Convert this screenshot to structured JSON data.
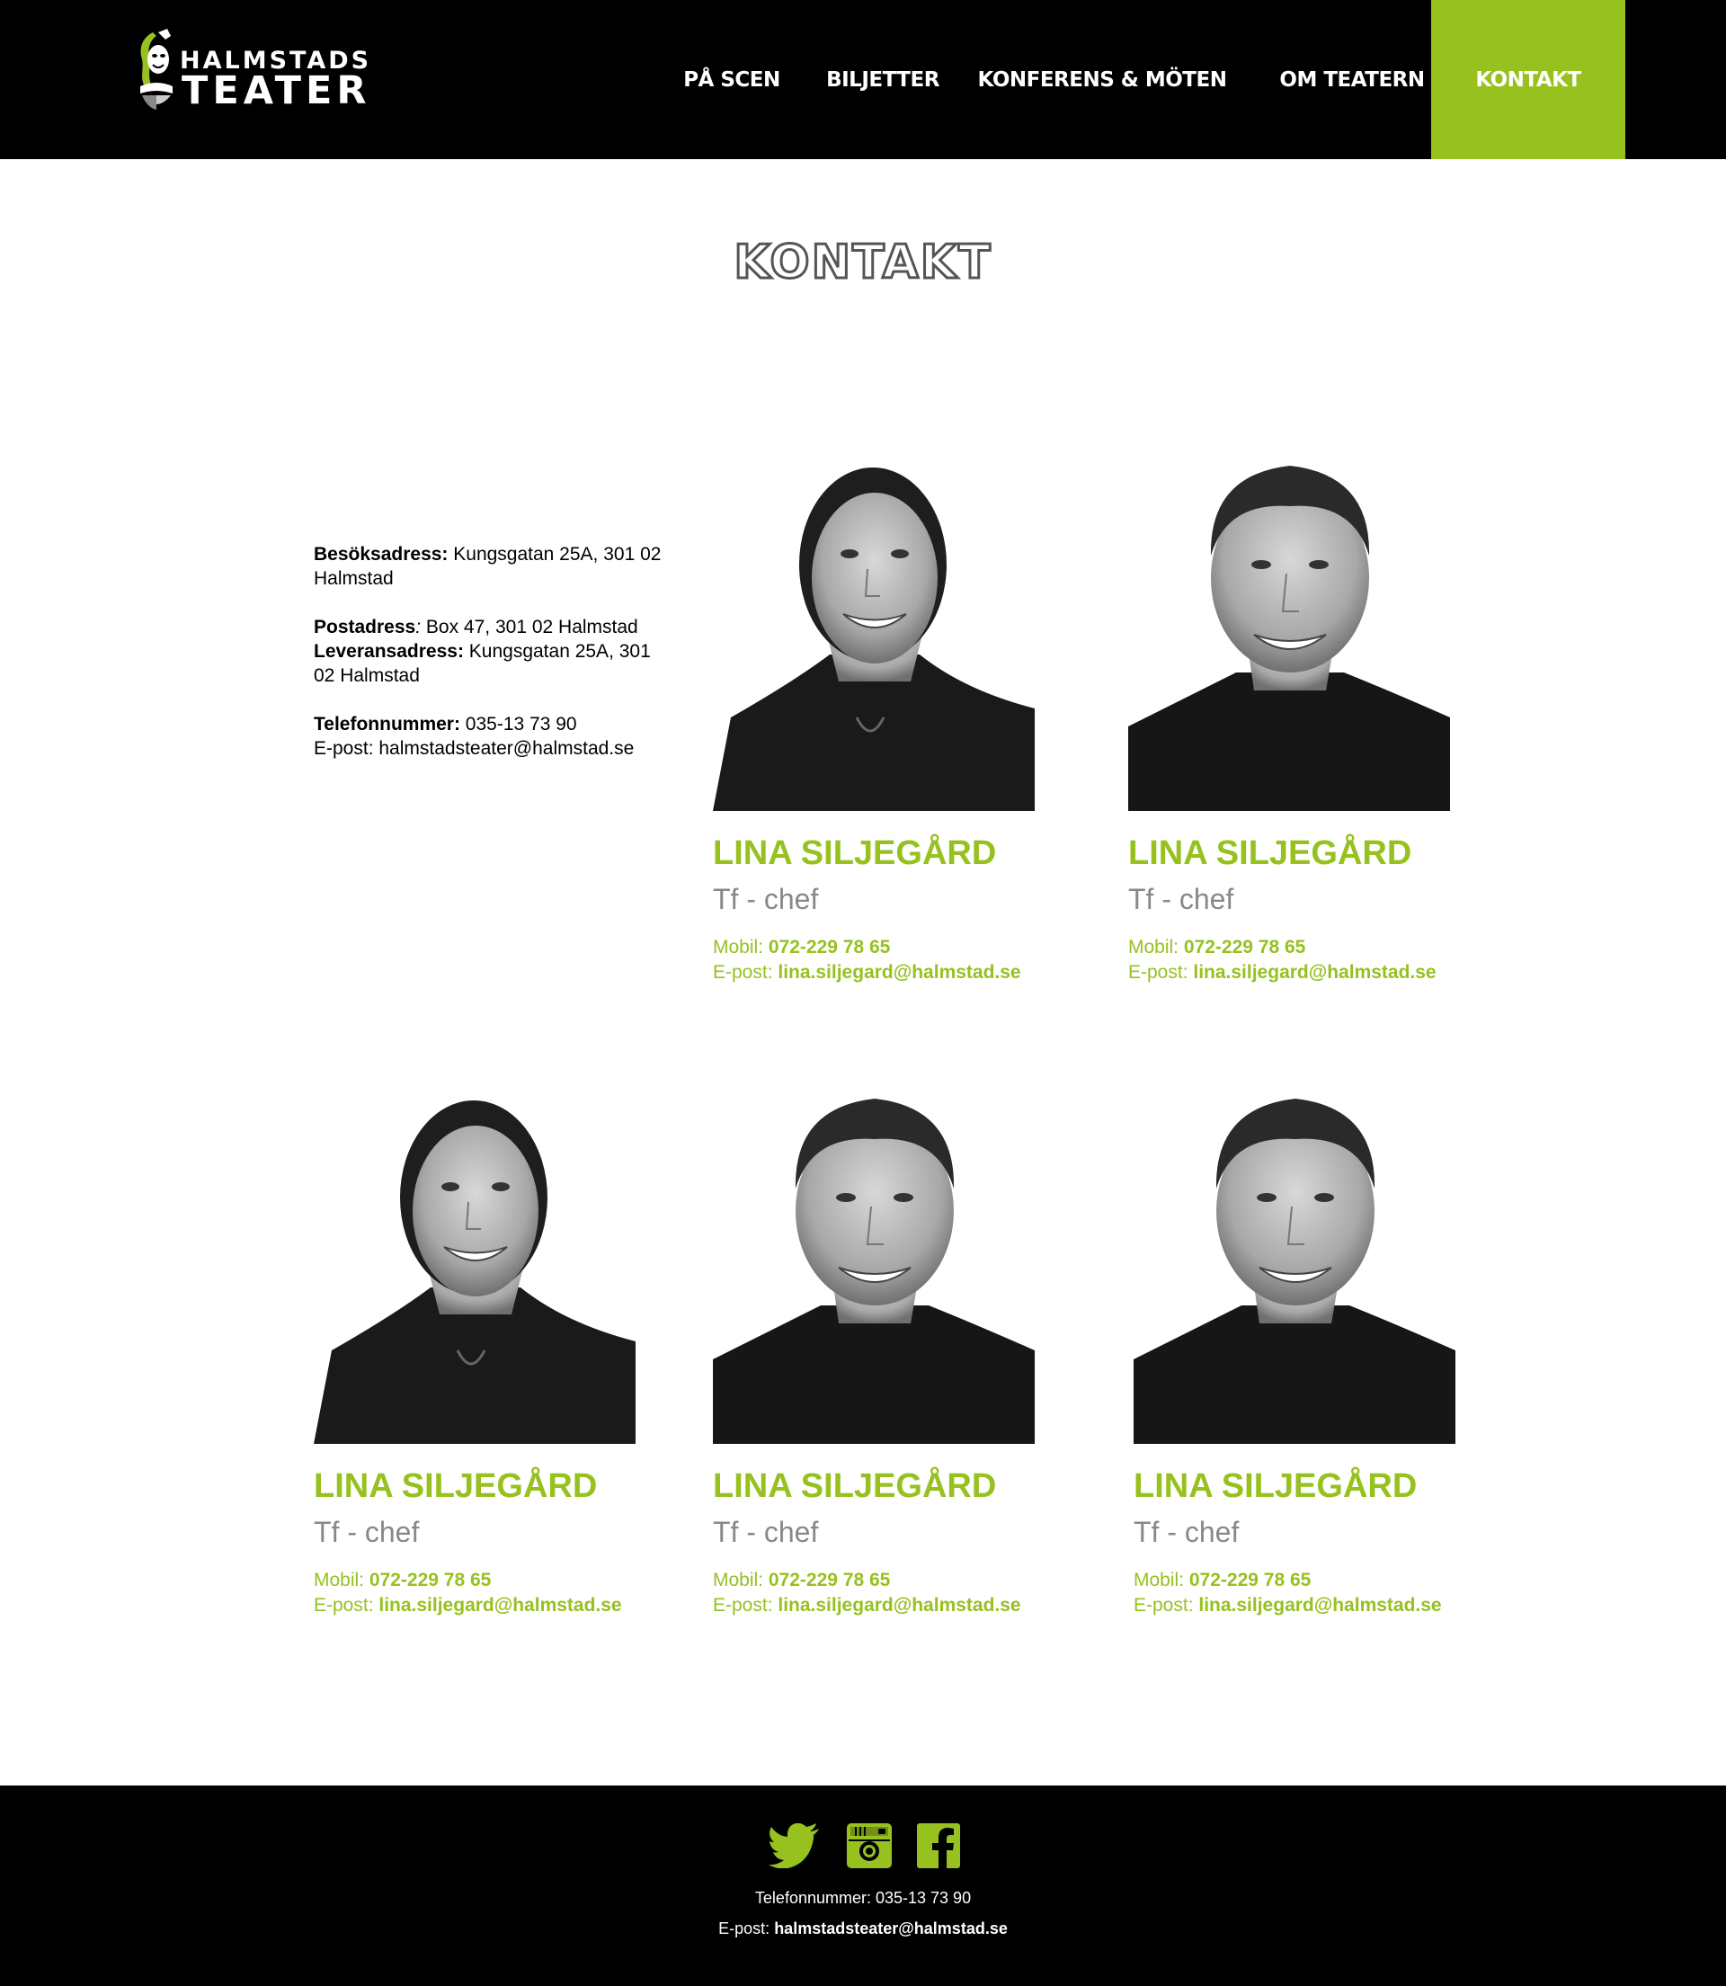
{
  "header": {
    "logo_top": "HALMSTADS",
    "logo_bottom": "TEATER",
    "nav": [
      {
        "label": "PÅ SCEN"
      },
      {
        "label": "BILJETTER"
      },
      {
        "label": "KONFERENS & MÖTEN"
      },
      {
        "label": "OM TEATERN"
      },
      {
        "label": "KONTAKT"
      }
    ]
  },
  "page": {
    "title": "KONTAKT"
  },
  "info": {
    "visit_label": "Besöksadress:",
    "visit_value": " Kungsgatan 25A, 301 02  Halmstad",
    "post_label": "Postadress",
    "post_colon": ":",
    "post_value": " Box 47, 301 02  Halmstad",
    "delivery_label": "Leveransadress:",
    "delivery_value": " Kungsgatan 25A, 301 02 Halmstad",
    "phone_label": "Telefonnummer:",
    "phone_value": " 035-13 73 90",
    "email_label": "E-post:",
    "email_value": " halmstadsteater@halmstad.se"
  },
  "staff": [
    {
      "name": "LINA SILJEGÅRD",
      "role": "Tf - chef",
      "mobile_label": "Mobil:",
      "mobile": " 072-229 78 65",
      "email_label": "E-post:",
      "email": " lina.siljegard@halmstad.se",
      "photo": "woman-portrait"
    },
    {
      "name": "LINA SILJEGÅRD",
      "role": "Tf - chef",
      "mobile_label": "Mobil:",
      "mobile": " 072-229 78 65",
      "email_label": "E-post:",
      "email": " lina.siljegard@halmstad.se",
      "photo": "man-portrait"
    },
    {
      "name": "LINA SILJEGÅRD",
      "role": "Tf - chef",
      "mobile_label": "Mobil:",
      "mobile": " 072-229 78 65",
      "email_label": "E-post:",
      "email": " lina.siljegard@halmstad.se",
      "photo": "woman-portrait"
    },
    {
      "name": "LINA SILJEGÅRD",
      "role": "Tf - chef",
      "mobile_label": "Mobil:",
      "mobile": " 072-229 78 65",
      "email_label": "E-post:",
      "email": " lina.siljegard@halmstad.se",
      "photo": "man-portrait"
    },
    {
      "name": "LINA SILJEGÅRD",
      "role": "Tf - chef",
      "mobile_label": "Mobil:",
      "mobile": " 072-229 78 65",
      "email_label": "E-post:",
      "email": " lina.siljegard@halmstad.se",
      "photo": "man-portrait"
    }
  ],
  "footer": {
    "social": [
      {
        "icon": "twitter-icon"
      },
      {
        "icon": "instagram-icon"
      },
      {
        "icon": "facebook-icon"
      }
    ],
    "phone_label": "Telefonnummer:",
    "phone_value": " 035-13 73 90",
    "email_label": "E-post:",
    "email_value": " halmstadsteater@halmstad.se"
  },
  "colors": {
    "accent": "#96c11f",
    "header_bg": "#000000",
    "role_gray": "#888888",
    "title_outline": "#555555"
  }
}
